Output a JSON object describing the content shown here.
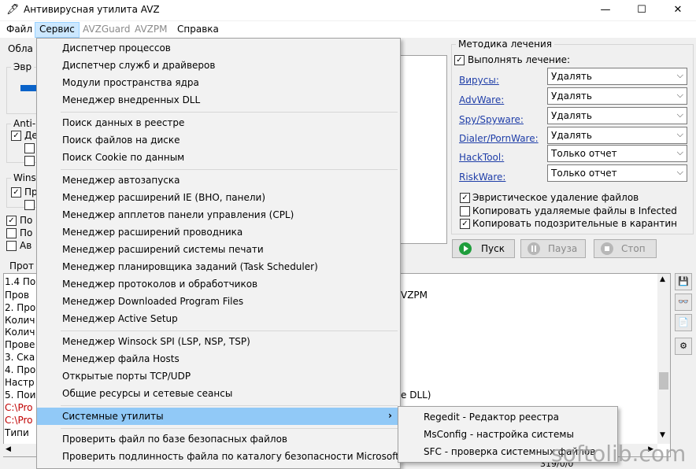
{
  "window": {
    "title": "Антивирусная утилита AVZ",
    "minimize": "—",
    "maximize": "☐",
    "close": "✕"
  },
  "menubar": {
    "file": "Файл",
    "service": "Сервис",
    "avzguard": "AVZGuard",
    "avzpm": "AVZPM",
    "help": "Справка"
  },
  "left": {
    "tab_fragment": "Обла",
    "heur_fragment": "Эвр",
    "anti_fragment": "Anti-",
    "anti_cb_fragment": "Де",
    "wins_fragment": "Wins",
    "wins_cb_fragment": "Пр",
    "cb1_fragment": "По",
    "cb2_fragment": "По",
    "cb3_fragment": "Ав",
    "prot_fragment": "Прот"
  },
  "treatment": {
    "title": "Методика лечения",
    "perform_label": "Выполнять лечение:",
    "rows": [
      {
        "label": "Вирусы:",
        "value": "Удалять"
      },
      {
        "label": "AdvWare:",
        "value": "Удалять"
      },
      {
        "label": "Spy/Spyware:",
        "value": "Удалять"
      },
      {
        "label": "Dialer/PornWare:",
        "value": "Удалять"
      },
      {
        "label": "HackTool:",
        "value": "Только отчет"
      },
      {
        "label": "RiskWare:",
        "value": "Только отчет"
      }
    ],
    "heur_delete": "Эвристическое удаление файлов",
    "copy_deleted": "Копировать удаляемые файлы в  Infected",
    "copy_suspicious": "Копировать подозрительные в  карантин"
  },
  "buttons": {
    "start": "Пуск",
    "pause": "Пауза",
    "stop": "Стоп"
  },
  "log": {
    "left_lines": [
      "1.4 По",
      "Пров",
      "2. Про",
      "Колич",
      "Колич",
      "Прове",
      "3. Ска",
      "4. Про",
      "Настр",
      "5. Пои",
      "C:\\Pro",
      "C:\\Pro",
      "Типи"
    ],
    "right_fragment_1": "VZPM",
    "right_fragment_2": "e DLL)",
    "status": "319/0/0"
  },
  "service_menu": [
    "Диспетчер процессов",
    "Диспетчер служб и драйверов",
    "Модули пространства ядра",
    "Менеджер внедренных DLL",
    "Поиск данных  в реестре",
    "Поиск файлов на диске",
    "Поиск Cookie по данным",
    "Менеджер автозапуска",
    "Менеджер расширений IE (BHO, панели)",
    "Менеджер апплетов панели управления (CPL)",
    "Менеджер расширений проводника",
    "Менеджер расширений системы печати",
    "Менеджер планировщика заданий (Task Scheduler)",
    "Менеджер протоколов и обработчиков",
    "Менеджер Downloaded Program Files",
    "Менеджер Active Setup",
    "Менеджер Winsock SPI (LSP, NSP, TSP)",
    "Менеджер файла Hosts",
    "Открытые порты TCP/UDP",
    "Общие ресурсы и сетевые сеансы",
    "Системные утилиты",
    "Проверить файл по базе безопасных файлов",
    "Проверить подлинность файла по каталогу безопасности Microsoft"
  ],
  "system_utils_submenu": [
    "Regedit - Редактор реестра",
    "MsConfig - настройка системы",
    "SFC - проверка системных файлов"
  ],
  "watermark": "softolib.com",
  "colors": {
    "menu_highlight": "#91c9f7",
    "link": "#1f3ea8",
    "start_icon": "#1f9e3c"
  }
}
